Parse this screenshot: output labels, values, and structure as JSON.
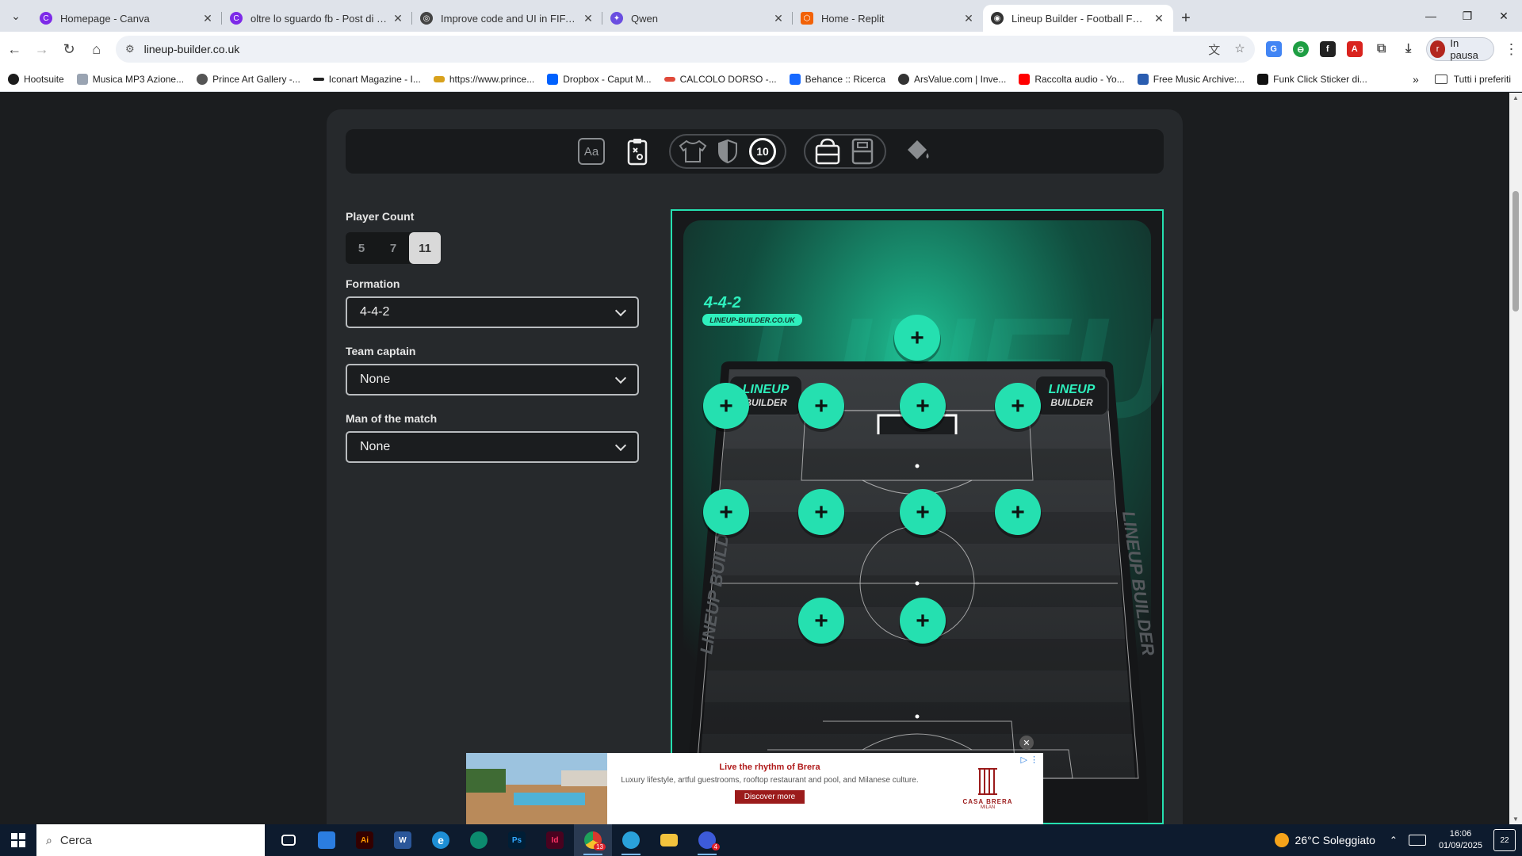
{
  "browser": {
    "tabs": [
      {
        "title": "Homepage - Canva",
        "fav_color": "#7d2ae8",
        "active": false
      },
      {
        "title": "oltre lo sguardo fb - Post di Fac",
        "fav_color": "#7d2ae8",
        "active": false
      },
      {
        "title": "Improve code and UI in FIFA sty",
        "fav_color": "#444444",
        "active": false
      },
      {
        "title": "Qwen",
        "fav_color": "#6a4ee0",
        "active": false
      },
      {
        "title": "Home - Replit",
        "fav_color": "#f26207",
        "active": false
      },
      {
        "title": "Lineup Builder - Football Forma",
        "fav_color": "#333333",
        "active": true
      }
    ],
    "url": "lineup-builder.co.uk",
    "profile_initial": "r",
    "profile_label": "In pausa",
    "bookmarks": [
      {
        "label": "Hootsuite",
        "color": "#1c1c1c"
      },
      {
        "label": "Musica MP3 Azione...",
        "color": "#9aa4b2"
      },
      {
        "label": "Prince Art Gallery -...",
        "color": "#555555"
      },
      {
        "label": "Iconart Magazine - I...",
        "color": "#222222"
      },
      {
        "label": "https://www.prince...",
        "color": "#d8a11c"
      },
      {
        "label": "Dropbox - Caput M...",
        "color": "#0061fe"
      },
      {
        "label": "CALCOLO DORSO -...",
        "color": "#e04a3a"
      },
      {
        "label": "Behance :: Ricerca",
        "color": "#1769ff"
      },
      {
        "label": "ArsValue.com | Inve...",
        "color": "#333333"
      },
      {
        "label": "Raccolta audio - Yo...",
        "color": "#ff0000"
      },
      {
        "label": "Free Music Archive:...",
        "color": "#2a5db0"
      },
      {
        "label": "Funk Click Sticker di...",
        "color": "#111111"
      }
    ],
    "bookmarks_all": "Tutti i preferiti"
  },
  "toolbar": {
    "icons": [
      "text-style-icon",
      "tactics-board-icon",
      "shirt-icon",
      "badge-shield-icon",
      "number-ten-icon",
      "goalkeeper-kit-icon",
      "outfield-kit-icon",
      "paint-bucket-icon"
    ],
    "number_label": "10",
    "text_style_label": "Aa"
  },
  "form": {
    "player_count_label": "Player Count",
    "player_counts": [
      "5",
      "7",
      "11"
    ],
    "selected_count": "11",
    "formation_label": "Formation",
    "formation_value": "4-4-2",
    "captain_label": "Team captain",
    "captain_value": "None",
    "motm_label": "Man of the match",
    "motm_value": "None"
  },
  "graphic": {
    "formation_text": "4-4-2",
    "site_tag": "LINEUP-BUILDER.CO.UK",
    "watermark": "LINEUP",
    "side_text": "LINEUP BUILDER",
    "board_line1": "LINEUP",
    "board_line2": "BUILDER",
    "accent": "#25e0b0",
    "add_symbol": "+"
  },
  "ad": {
    "title": "Live the rhythm of Brera",
    "text": "Luxury lifestyle, artful guestrooms, rooftop restaurant and pool, and Milanese culture.",
    "button": "Discover more",
    "logo_name": "CASA BRERA",
    "logo_sub": "MILAN"
  },
  "taskbar": {
    "search_placeholder": "Cerca",
    "weather": "26°C Soleggiato",
    "time": "16:06",
    "date": "01/09/2025",
    "notifications": "22",
    "apps": [
      {
        "name": "task-view-icon",
        "label": "",
        "color": "#0d1b2e"
      },
      {
        "name": "store-icon",
        "label": "",
        "color": "#2b7de0"
      },
      {
        "name": "illustrator-icon",
        "label": "Ai",
        "color": "#330000"
      },
      {
        "name": "word-icon",
        "label": "",
        "color": "#2b579a"
      },
      {
        "name": "ie-icon",
        "label": "e",
        "color": "#1e8fd6"
      },
      {
        "name": "edge-icon",
        "label": "",
        "color": "#0c8a6e"
      },
      {
        "name": "photoshop-icon",
        "label": "Ps",
        "color": "#001e36"
      },
      {
        "name": "indesign-icon",
        "label": "Id",
        "color": "#49021f"
      },
      {
        "name": "chrome-icon",
        "label": "",
        "color": "#d9392e"
      },
      {
        "name": "telegram-icon",
        "label": "",
        "color": "#2aa1da"
      },
      {
        "name": "explorer-icon",
        "label": "",
        "color": "#f3c33d"
      },
      {
        "name": "copilot-icon",
        "label": "",
        "color": "#3d5bd9"
      }
    ],
    "chrome_badge": "13",
    "copilot_badge": "4"
  }
}
